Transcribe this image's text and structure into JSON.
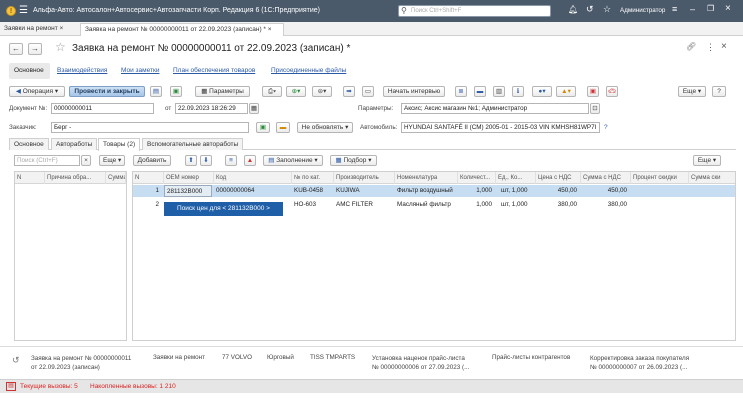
{
  "app": {
    "title": "Альфа-Авто: Автосалон+Автосервис+Автозапчасти Корп. Редакция 6  (1С:Предприятие)",
    "search_placeholder": "Поиск Ctrl+Shift+F",
    "user": "Администратор"
  },
  "tabs": [
    {
      "label": "Заявки на ремонт"
    },
    {
      "label": "Заявка на ремонт № 00000000011 от 22.09.2023 (записан) *"
    }
  ],
  "document": {
    "title": "Заявка на ремонт № 00000000011 от 22.09.2023 (записан) *"
  },
  "nav": {
    "main": "Основное",
    "links": [
      "Взаимодействия",
      "Мои заметки",
      "План обеспечения товаров",
      "Присоединенные файлы"
    ]
  },
  "toolbar": {
    "operation": "Операция",
    "post_close": "Провести и закрыть",
    "params": "Параметры",
    "interview": "Начать интервью",
    "more": "Еще",
    "help": "?"
  },
  "header": {
    "doc_no_label": "Документ №:",
    "doc_no": "00000000011",
    "date_label": "от",
    "date": "22.09.2023 18:26:29",
    "params_label": "Параметры:",
    "params_value": "Аксис; Аксис магазин №1; Администратор",
    "customer_label": "Заказчик:",
    "customer": "Берг -",
    "update_mode": "Не обновлять",
    "car_label": "Автомобиль:",
    "car": "HYUNDAI SANTAFÉ II (CM) 2005-01 - 2015-03 VIN KMHSH81WP7I",
    "car_help": "?"
  },
  "form_tabs": [
    "Основное",
    "Автоработы",
    "Товары (2)",
    "Вспомогательные автоработы"
  ],
  "left_panel": {
    "search_placeholder": "Поиск (Ctrl+F)",
    "clear": "×",
    "more": "Еще",
    "columns": [
      "N",
      "Причина обра...",
      "Сумма"
    ]
  },
  "goods_toolbar": {
    "add": "Добавить",
    "fill": "Заполнение",
    "pick": "Подбор",
    "more": "Еще"
  },
  "grid": {
    "columns": [
      "N",
      "ОЕМ номер",
      "Код",
      "№ по кат.",
      "Производитель",
      "Номенклатура",
      "Количест...",
      "Ед., Ко...",
      "Цена с НДС",
      "Сумма с НДС",
      "Процент скидки",
      "Сумма ски"
    ],
    "rows": [
      [
        "1",
        "281132В000",
        "00000000064",
        "KUB-0458",
        "KUJIWA",
        "Фильтр воздушный",
        "1,000",
        "шт, 1,000",
        "450,00",
        "450,00"
      ],
      [
        "2",
        "",
        "",
        "НО-603",
        "AMC FILTER",
        "Масляный фильтр",
        "1,000",
        "шт, 1,000",
        "380,00",
        "380,00"
      ]
    ]
  },
  "tooltip": "Поиск цен для < 281132В000 >",
  "related": [
    {
      "l1": "Заявка на ремонт № 00000000011",
      "l2": "от 22.09.2023 (записан)"
    },
    {
      "l1": "Заявки на ремонт",
      "l2": ""
    },
    {
      "l1": "77 VOLVO",
      "l2": ""
    },
    {
      "l1": "Юрговый",
      "l2": ""
    },
    {
      "l1": "TISS TMPARTS",
      "l2": ""
    },
    {
      "l1": "Установка наценок прайс-листа",
      "l2": "№ 00000000006 от 27.09.2023 (..."
    },
    {
      "l1": "Прайс-листы контрагентов",
      "l2": ""
    },
    {
      "l1": "Корректировка заказа покупателя",
      "l2": "№ 00000000007 от 26.09.2023 (..."
    }
  ],
  "status": {
    "current": "Текущие вызовы: 5",
    "accumulated": "Накопленные вызовы: 1 210"
  },
  "colors": {
    "accent": "#4b5a6b",
    "selected_row": "#c7ddf2",
    "tooltip": "#1f5fa8",
    "status_red": "#d22"
  }
}
